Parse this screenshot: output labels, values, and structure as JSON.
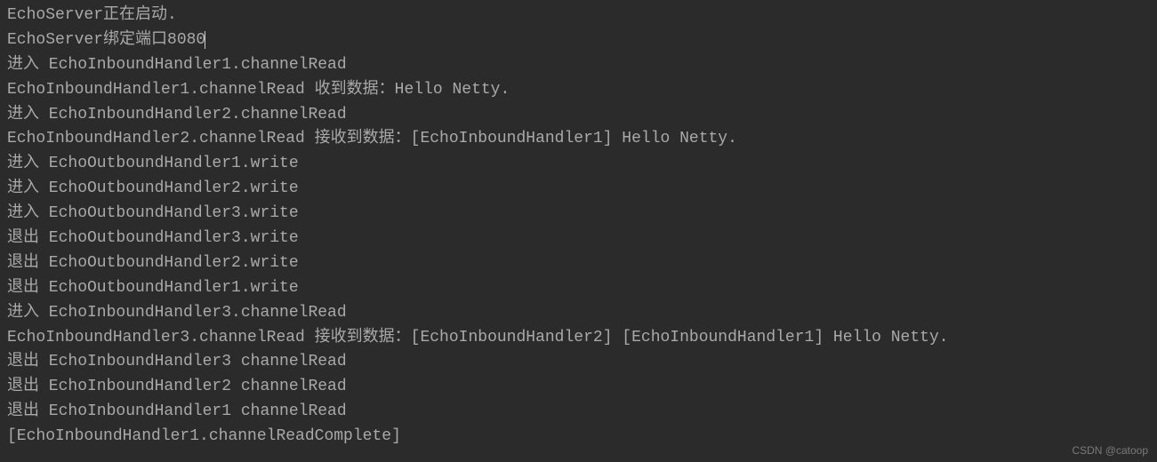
{
  "console": {
    "lines": [
      "EchoServer正在启动.",
      "EchoServer绑定端口8080",
      "进入 EchoInboundHandler1.channelRead",
      "EchoInboundHandler1.channelRead 收到数据：Hello Netty.",
      "进入 EchoInboundHandler2.channelRead",
      "EchoInboundHandler2.channelRead 接收到数据：[EchoInboundHandler1] Hello Netty.",
      "进入 EchoOutboundHandler1.write",
      "进入 EchoOutboundHandler2.write",
      "进入 EchoOutboundHandler3.write",
      "退出 EchoOutboundHandler3.write",
      "退出 EchoOutboundHandler2.write",
      "退出 EchoOutboundHandler1.write",
      "进入 EchoInboundHandler3.channelRead",
      "EchoInboundHandler3.channelRead 接收到数据：[EchoInboundHandler2] [EchoInboundHandler1] Hello Netty.",
      "退出 EchoInboundHandler3 channelRead",
      "退出 EchoInboundHandler2 channelRead",
      "退出 EchoInboundHandler1 channelRead",
      "[EchoInboundHandler1.channelReadComplete]"
    ],
    "cursor_line_index": 1
  },
  "watermark": "CSDN @catoop"
}
